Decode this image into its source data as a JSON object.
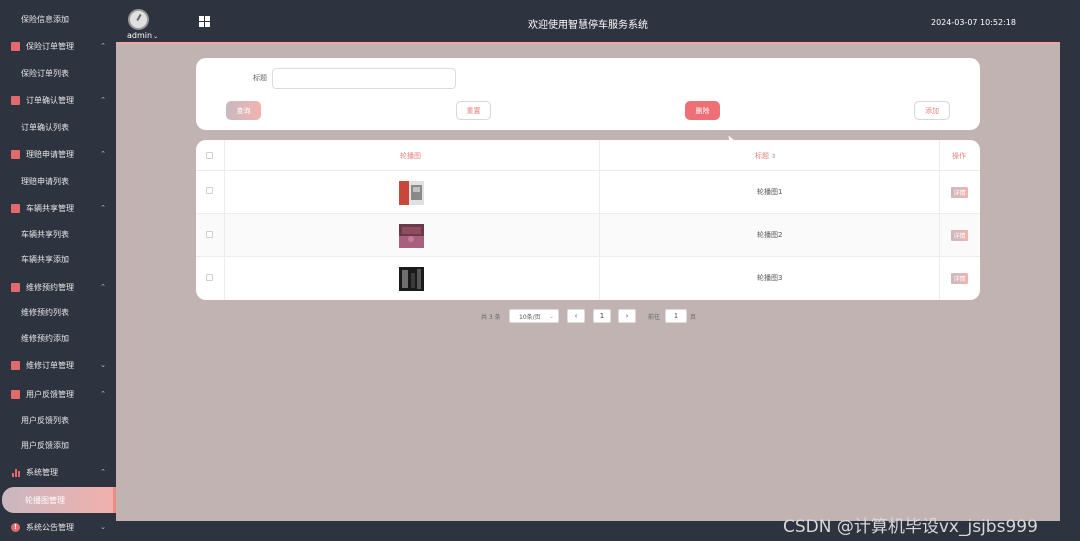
{
  "sidebar": {
    "items": [
      {
        "label": "保险信息添加",
        "type": "sub"
      },
      {
        "label": "保险订单管理",
        "type": "group",
        "icon": "checkbox-icon",
        "chevron": "⌃"
      },
      {
        "label": "保险订单列表",
        "type": "sub"
      },
      {
        "label": "订单确认管理",
        "type": "group",
        "icon": "checkbox-icon",
        "chevron": "⌃"
      },
      {
        "label": "订单确认列表",
        "type": "sub"
      },
      {
        "label": "理赔申请管理",
        "type": "group",
        "icon": "checkbox-icon",
        "chevron": "⌃"
      },
      {
        "label": "理赔申请列表",
        "type": "sub"
      },
      {
        "label": "车辆共享管理",
        "type": "group",
        "icon": "checkbox-icon",
        "chevron": "⌃"
      },
      {
        "label": "车辆共享列表",
        "type": "sub"
      },
      {
        "label": "车辆共享添加",
        "type": "sub"
      },
      {
        "label": "维修预约管理",
        "type": "group",
        "icon": "checkbox-icon",
        "chevron": "⌃"
      },
      {
        "label": "维修预约列表",
        "type": "sub"
      },
      {
        "label": "维修预约添加",
        "type": "sub"
      },
      {
        "label": "维修订单管理",
        "type": "group",
        "icon": "checkbox-icon",
        "chevron": "⌄"
      },
      {
        "label": "用户反馈管理",
        "type": "group",
        "icon": "checkbox-icon",
        "chevron": "⌃"
      },
      {
        "label": "用户反馈列表",
        "type": "sub"
      },
      {
        "label": "用户反馈添加",
        "type": "sub"
      },
      {
        "label": "系统管理",
        "type": "group",
        "icon": "bar-chart-icon",
        "chevron": "⌃"
      },
      {
        "label": "轮播图管理",
        "type": "sub",
        "active": true
      },
      {
        "label": "系统公告管理",
        "type": "group",
        "icon": "alert-icon",
        "chevron": "⌄"
      }
    ]
  },
  "header": {
    "user": "admin",
    "user_caret": "⌄",
    "title": "欢迎使用智慧停车服务系统",
    "datetime": "2024-03-07 10:52:18"
  },
  "search": {
    "label": "标题",
    "input_value": "",
    "buttons": {
      "query": "查询",
      "reset": "重置",
      "delete": "删除",
      "add": "添加"
    }
  },
  "table": {
    "headers": {
      "image": "轮播图",
      "title": "标题",
      "sort_icon": "⇕",
      "action": "操作"
    },
    "rows": [
      {
        "title": "轮播图1",
        "action": "详情",
        "thumb_colors": [
          "#c9463a",
          "#e1e1e1"
        ]
      },
      {
        "title": "轮播图2",
        "action": "详情",
        "thumb_colors": [
          "#8e4e5e",
          "#a8607d"
        ]
      },
      {
        "title": "轮播图3",
        "action": "详情",
        "thumb_colors": [
          "#1a1a1a",
          "#6e6e6e"
        ]
      }
    ]
  },
  "pagination": {
    "total": "共 3 条",
    "page_size": "10条/页",
    "prev": "‹",
    "current": "1",
    "next": "›",
    "goto_label": "前往",
    "goto_value": "1",
    "page_suffix": "页"
  },
  "watermark": "CSDN @计算机毕设vx_jsjbs999",
  "colors": {
    "accent": "#e57f7f",
    "delete": "#ee6f75",
    "main_bg": "#c2b3b3",
    "sidebar_bg": "#2e3340"
  }
}
